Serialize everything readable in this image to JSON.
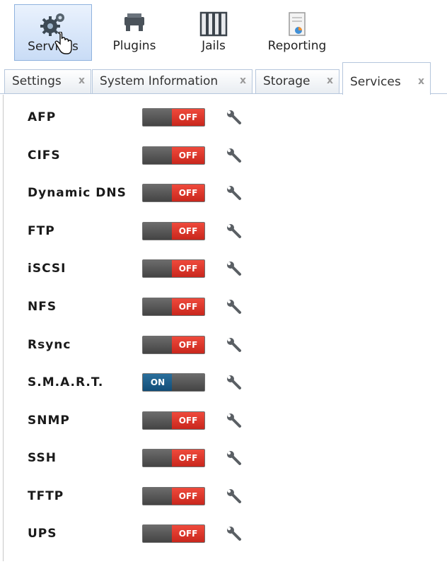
{
  "toolbar": {
    "buttons": [
      {
        "label": "Services",
        "icon": "gears-icon",
        "active": true
      },
      {
        "label": "Plugins",
        "icon": "plugin-icon"
      },
      {
        "label": "Jails",
        "icon": "jail-icon"
      },
      {
        "label": "Reporting",
        "icon": "report-icon"
      }
    ]
  },
  "tabs": [
    {
      "label": "Settings",
      "close": "x"
    },
    {
      "label": "System Information",
      "close": "x"
    },
    {
      "label": "Storage",
      "close": "x"
    },
    {
      "label": "Services",
      "close": "x",
      "active": true
    }
  ],
  "services": [
    {
      "name": "AFP",
      "state": "OFF"
    },
    {
      "name": "CIFS",
      "state": "OFF"
    },
    {
      "name": "Dynamic DNS",
      "state": "OFF"
    },
    {
      "name": "FTP",
      "state": "OFF"
    },
    {
      "name": "iSCSI",
      "state": "OFF"
    },
    {
      "name": "NFS",
      "state": "OFF"
    },
    {
      "name": "Rsync",
      "state": "OFF"
    },
    {
      "name": "S.M.A.R.T.",
      "state": "ON"
    },
    {
      "name": "SNMP",
      "state": "OFF"
    },
    {
      "name": "SSH",
      "state": "OFF"
    },
    {
      "name": "TFTP",
      "state": "OFF"
    },
    {
      "name": "UPS",
      "state": "OFF"
    }
  ],
  "colors": {
    "off": "#d9342a",
    "on": "#1b5c88",
    "active_tab_border": "#b5c6dc"
  }
}
